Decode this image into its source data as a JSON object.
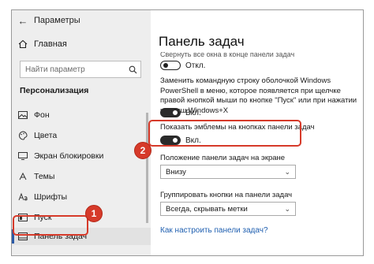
{
  "window": {
    "title": "Параметры",
    "back_glyph": "←"
  },
  "sidebar": {
    "home_label": "Главная",
    "search_placeholder": "Найти параметр",
    "section_title": "Персонализация",
    "items": [
      {
        "label": "Фон",
        "icon": "image-icon"
      },
      {
        "label": "Цвета",
        "icon": "palette-icon"
      },
      {
        "label": "Экран блокировки",
        "icon": "lock-screen-icon"
      },
      {
        "label": "Темы",
        "icon": "themes-icon"
      },
      {
        "label": "Шрифты",
        "icon": "fonts-icon"
      },
      {
        "label": "Пуск",
        "icon": "start-icon"
      },
      {
        "label": "Панель задач",
        "icon": "taskbar-icon",
        "active": true
      }
    ]
  },
  "main": {
    "title": "Панель задач",
    "cut_text": "Свернуть все окна в конце панели задач",
    "toggle1": {
      "label": "Откл.",
      "state": "off"
    },
    "powershell_desc": "Заменить командную строку оболочкой Windows PowerShell в меню, которое появляется при щелчке правой кнопкой мыши по кнопке \"Пуск\" или при нажатии клавиш Windows+X",
    "toggle2": {
      "label": "Вкл.",
      "state": "on"
    },
    "badges_label": "Показать эмблемы на кнопках панели задач",
    "toggle3": {
      "label": "Вкл.",
      "state": "on"
    },
    "position_label": "Положение панели задач на экране",
    "position_value": "Внизу",
    "group_label": "Группировать кнопки на панели задач",
    "group_value": "Всегда, скрывать метки",
    "link": "Как настроить панели задач?"
  },
  "annotations": {
    "step1": "1",
    "step2": "2",
    "color": "#d63a2a"
  },
  "colors": {
    "accent": "#2a5aa7",
    "link": "#1f5fb0",
    "sidebar_bg": "#eeeeee"
  }
}
